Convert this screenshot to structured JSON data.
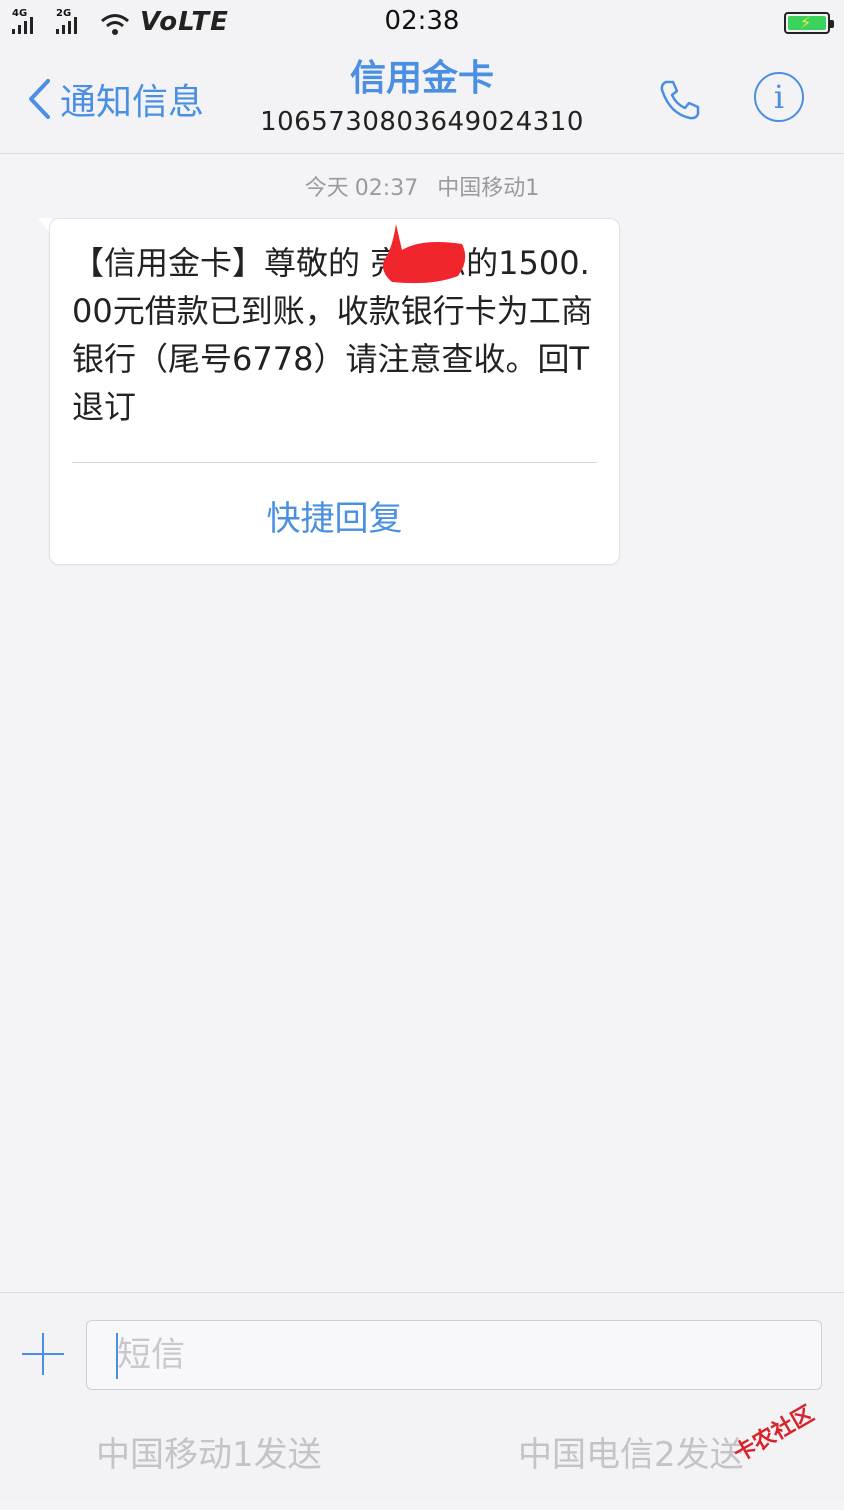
{
  "status_bar": {
    "signal_1_network": "4G",
    "signal_2_network": "2G",
    "volte_label": "VoLTE",
    "time": "02:38"
  },
  "nav": {
    "back_label": "通知信息",
    "contact_name": "信用金卡",
    "contact_number": "1065730803649024310",
    "accent_color": "#4a8fe2"
  },
  "message": {
    "day": "今天",
    "time": "02:37",
    "carrier": "中国移动1",
    "body": "【信用金卡】尊敬的      亮，您的1500.00元借款已到账，收款银行卡为工商银行（尾号6778）请注意查收。回T退订",
    "quick_reply_label": "快捷回复"
  },
  "composer": {
    "placeholder": "短信",
    "send_sim1_label": "中国移动1发送",
    "send_sim2_label": "中国电信2发送"
  },
  "watermark": {
    "text": "卡农社区"
  },
  "icons": {
    "back": "chevron-left-icon",
    "call": "phone-icon",
    "info": "info-icon",
    "add": "plus-icon"
  }
}
